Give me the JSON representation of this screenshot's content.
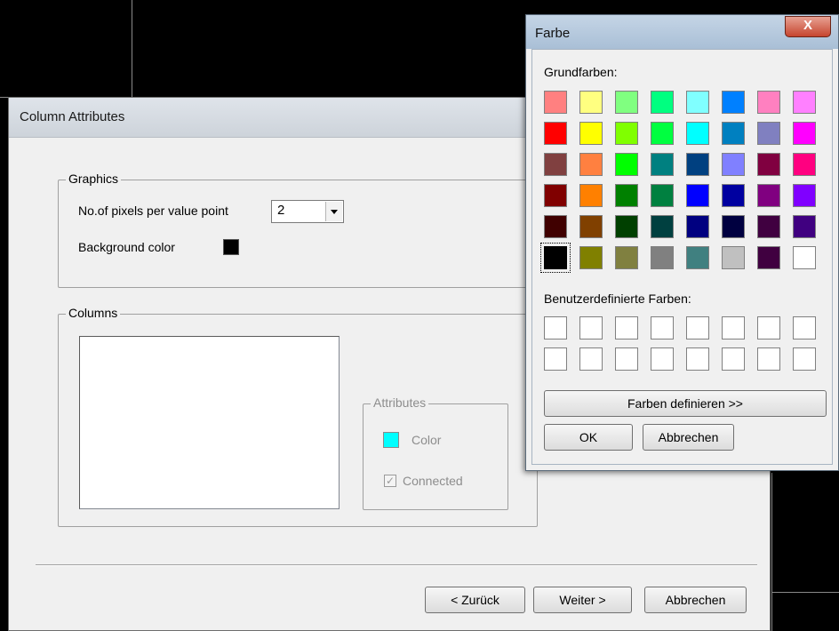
{
  "column_attributes": {
    "title": "Column Attributes",
    "graphics": {
      "legend": "Graphics",
      "pixels_label": "No.of pixels per value point",
      "pixels_value": "2",
      "background_label": "Background color",
      "background_color": "#000000"
    },
    "columns": {
      "legend": "Columns",
      "attributes": {
        "legend": "Attributes",
        "color_label": "Color",
        "color_value": "#00ffff",
        "connected_label": "Connected",
        "connected_checked": true
      }
    },
    "buttons": {
      "back_label": "< Zurück",
      "next_label": "Weiter >",
      "cancel_label": "Abbrechen"
    }
  },
  "farbe": {
    "title": "Farbe",
    "close_label": "X",
    "basic_colors_label": "Grundfarben:",
    "basic_colors": [
      [
        "#ff8080",
        "#ffff80",
        "#80ff80",
        "#00ff80",
        "#80ffff",
        "#0080ff",
        "#ff80c0",
        "#ff80ff"
      ],
      [
        "#ff0000",
        "#ffff00",
        "#80ff00",
        "#00ff40",
        "#00ffff",
        "#0080c0",
        "#8080c0",
        "#ff00ff"
      ],
      [
        "#804040",
        "#ff8040",
        "#00ff00",
        "#008080",
        "#004080",
        "#8080ff",
        "#800040",
        "#ff0080"
      ],
      [
        "#800000",
        "#ff8000",
        "#008000",
        "#008040",
        "#0000ff",
        "#0000a0",
        "#800080",
        "#8000ff"
      ],
      [
        "#400000",
        "#804000",
        "#004000",
        "#004040",
        "#000080",
        "#000040",
        "#400040",
        "#400080"
      ],
      [
        "#000000",
        "#808000",
        "#808040",
        "#808080",
        "#408080",
        "#c0c0c0",
        "#400040",
        "#ffffff"
      ]
    ],
    "selected": "#000000",
    "custom_colors_label": "Benutzerdefinierte Farben:",
    "define_button_label": "Farben definieren >>",
    "ok_label": "OK",
    "cancel_label": "Abbrechen"
  }
}
